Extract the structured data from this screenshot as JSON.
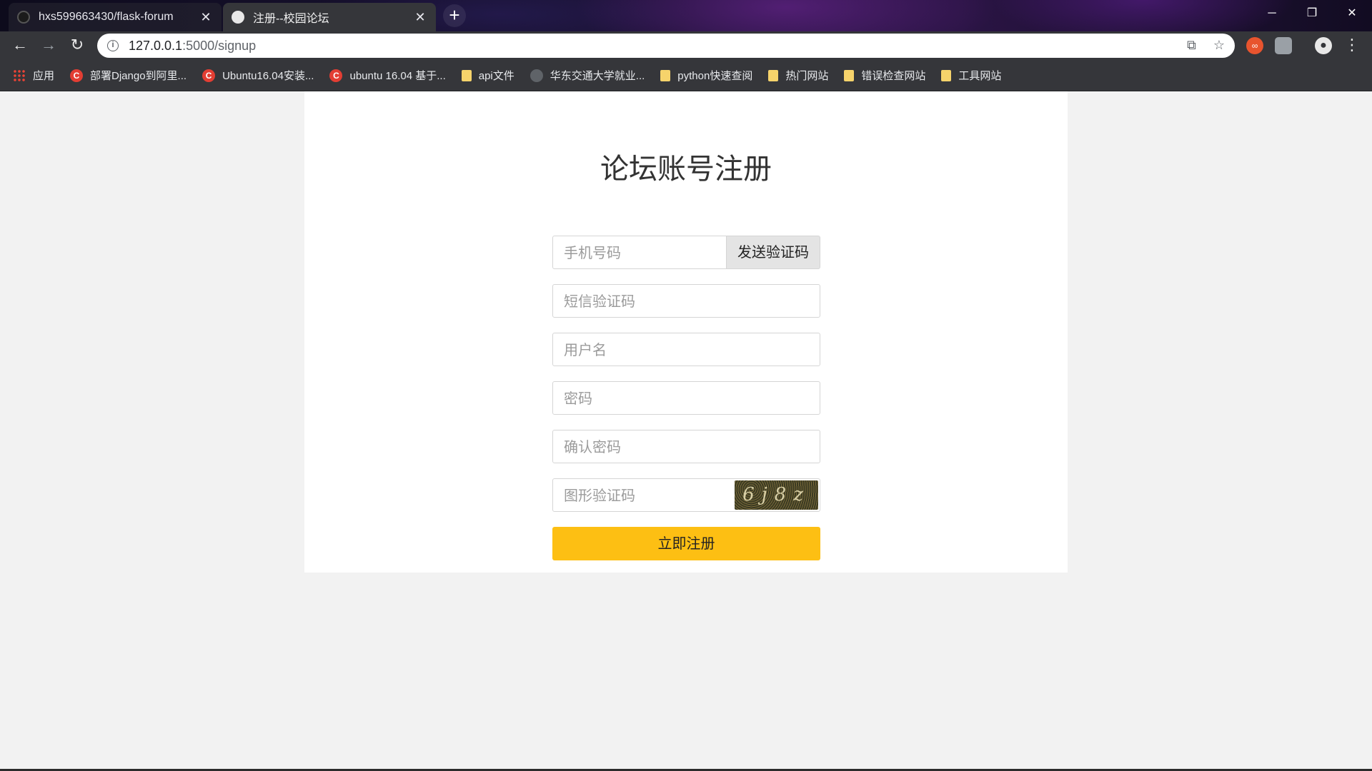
{
  "browser": {
    "tabs": [
      {
        "title": "hxs599663430/flask-forum",
        "close": "✕"
      },
      {
        "title": "注册--校园论坛",
        "close": "✕"
      }
    ],
    "new_tab": "+",
    "window_controls": {
      "minimize": "─",
      "maximize": "❐",
      "close": "✕"
    },
    "nav": {
      "back": "←",
      "forward": "→",
      "reload": "↻"
    },
    "url": {
      "host": "127.0.0.1",
      "rest": ":5000/signup"
    },
    "omnibox_icons": [
      "translate-icon",
      "star-icon"
    ],
    "extensions": [
      "extension-red-icon",
      "extension-grey-icon"
    ],
    "bookmarks": [
      {
        "icon": "apps",
        "label": "应用"
      },
      {
        "icon": "csdn",
        "label": "部署Django到阿里..."
      },
      {
        "icon": "csdn",
        "label": "Ubuntu16.04安装..."
      },
      {
        "icon": "csdn",
        "label": "ubuntu 16.04 基于..."
      },
      {
        "icon": "folder",
        "label": "api文件"
      },
      {
        "icon": "globe",
        "label": "华东交通大学就业..."
      },
      {
        "icon": "folder",
        "label": "python快速查阅"
      },
      {
        "icon": "folder",
        "label": "热门网站"
      },
      {
        "icon": "folder",
        "label": "错误检查网站"
      },
      {
        "icon": "folder",
        "label": "工具网站"
      }
    ]
  },
  "form": {
    "title": "论坛账号注册",
    "phone_placeholder": "手机号码",
    "send_code_label": "发送验证码",
    "sms_placeholder": "短信验证码",
    "username_placeholder": "用户名",
    "password_placeholder": "密码",
    "confirm_placeholder": "确认密码",
    "captcha_placeholder": "图形验证码",
    "captcha_text": "6j8z",
    "submit_label": "立即注册"
  },
  "colors": {
    "accent": "#fdbf13",
    "card": "#ffffff",
    "page_bg": "#f2f2f2"
  }
}
